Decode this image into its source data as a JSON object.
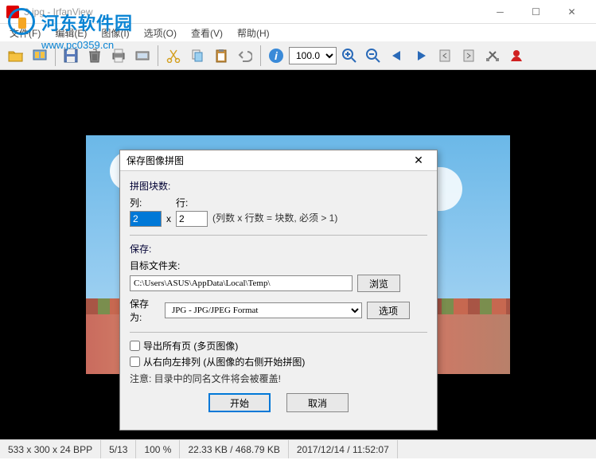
{
  "window": {
    "title": "3.jpg - IrfanView",
    "watermark_text": "河东软件园",
    "watermark_url": "www.pc0359.cn"
  },
  "menu": {
    "file": "文件(F)",
    "edit": "编辑(E)",
    "image": "图像(I)",
    "options": "选项(O)",
    "view": "查看(V)",
    "help": "帮助(H)"
  },
  "toolbar": {
    "zoom_value": "100.0"
  },
  "dialog": {
    "title": "保存图像拼图",
    "tiles_section": "拼图块数:",
    "cols_label": "列:",
    "rows_label": "行:",
    "cols_value": "2",
    "rows_value": "2",
    "tiles_hint": "(列数 x 行数 = 块数, 必须 > 1)",
    "save_section": "保存:",
    "target_folder_label": "目标文件夹:",
    "target_folder_value": "C:\\Users\\ASUS\\AppData\\Local\\Temp\\",
    "browse_btn": "浏览",
    "save_as_label": "保存为:",
    "format_value": "JPG - JPG/JPEG Format",
    "options_btn": "选项",
    "cb_export_all": "导出所有页 (多页图像)",
    "cb_right_to_left": "从右向左排列 (从图像的右侧开始拼图)",
    "warning": "注意: 目录中的同名文件将会被覆盖!",
    "start_btn": "开始",
    "cancel_btn": "取消"
  },
  "status": {
    "dimensions": "533 x 300 x 24 BPP",
    "index": "5/13",
    "zoom": "100 %",
    "size": "22.33 KB / 468.79 KB",
    "datetime": "2017/12/14 / 11:52:07"
  }
}
